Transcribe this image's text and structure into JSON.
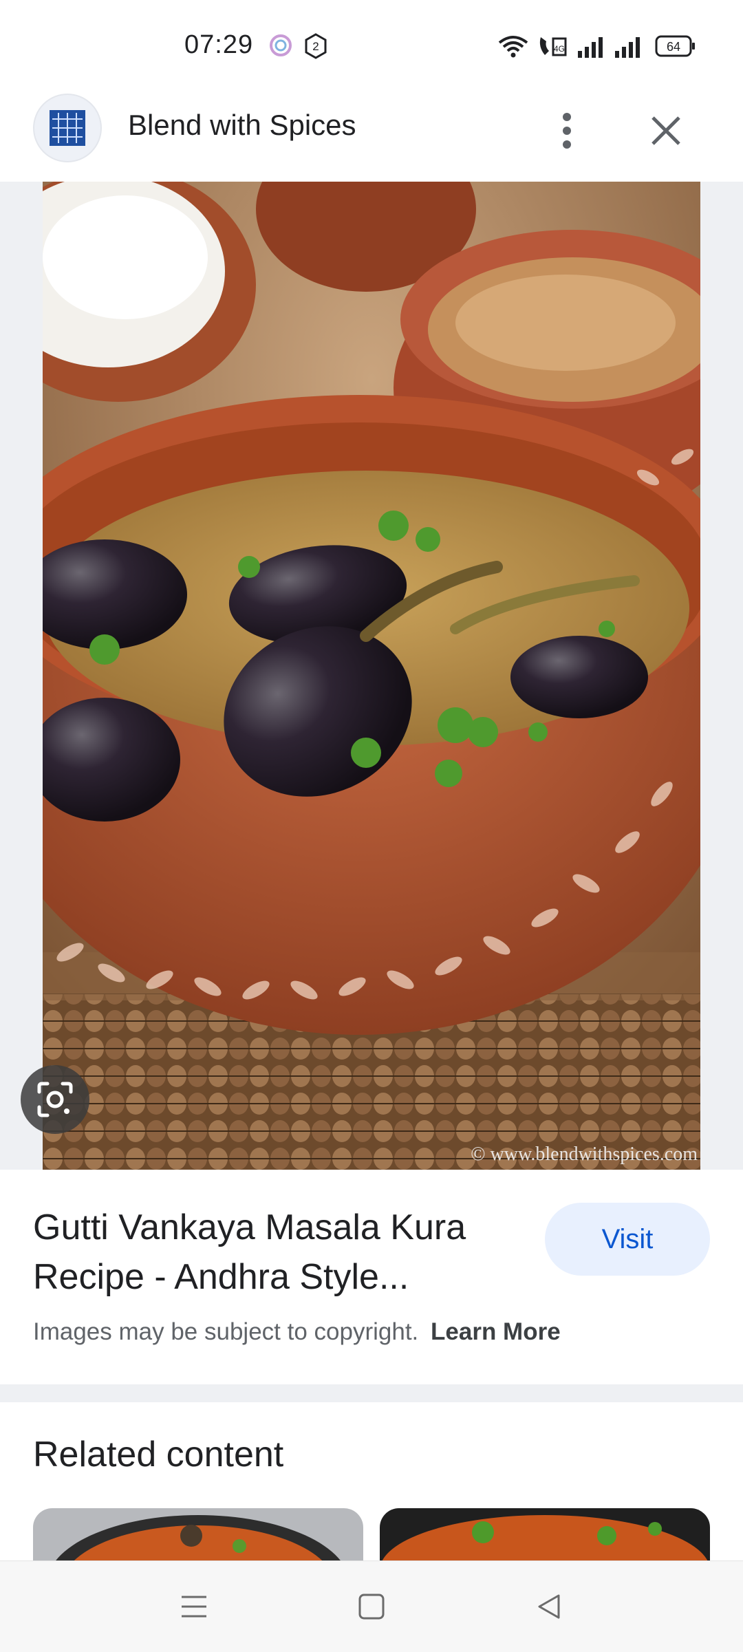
{
  "status_bar": {
    "time": "07:29",
    "battery_level": "64",
    "icons": [
      "assistant-icon",
      "notification-badge-icon",
      "wifi-icon",
      "volte-icon",
      "signal-icon",
      "signal-icon",
      "battery-icon"
    ],
    "notification_count": "2"
  },
  "header": {
    "site_name": "Blend with Spices",
    "icons": [
      "site-logo-icon",
      "more-vert-icon",
      "close-icon"
    ]
  },
  "image": {
    "watermark": "© www.blendwithspices.com",
    "lens_icon": "google-lens-icon"
  },
  "result": {
    "title": "Gutti Vankaya Masala Kura Recipe - Andhra Style...",
    "visit_label": "Visit",
    "copyright_text": "Images may be subject to copyright.",
    "learn_more_label": "Learn More"
  },
  "related": {
    "heading": "Related content"
  },
  "nav_bar": {
    "icons": [
      "recents-menu-icon",
      "home-square-icon",
      "back-triangle-icon"
    ]
  },
  "colors": {
    "accent": "#0b57d0",
    "visit_bg": "#e8f0fe",
    "terracotta": "#b85a34"
  }
}
